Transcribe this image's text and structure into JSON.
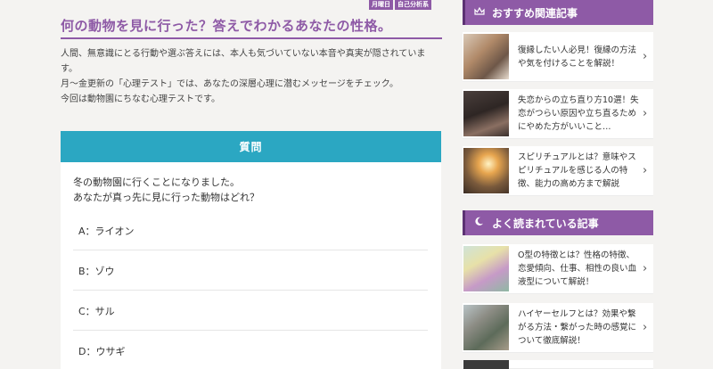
{
  "main": {
    "tags": [
      "月曜日",
      "自己分析系"
    ],
    "title": "何の動物を見に行った？答えでわかるあなたの性格。",
    "lead": [
      "人間、無意識にとる行動や選ぶ答えには、本人も気づいていない本音や真実が隠されています。",
      "月～金更新の「心理テスト」では、あなたの深層心理に潜むメッセージをチェック。",
      "今回は動物園にちなむ心理テストです。"
    ],
    "question": {
      "header": "質問",
      "lines": [
        "冬の動物園に行くことになりました。",
        "あなたが真っ先に見に行った動物はどれ？"
      ],
      "options": [
        "A：ライオン",
        "B：ゾウ",
        "C：サル",
        "D：ウサギ"
      ]
    }
  },
  "sidebar": {
    "recommended": {
      "title": "おすすめ関連記事",
      "icon": "crown-icon",
      "items": [
        {
          "text": "復縁したい人必見！復縁の方法や気を付けることを解説！"
        },
        {
          "text": "失恋からの立ち直り方10選！失恋がつらい原因や立ち直るためにやめた方がいいこと…"
        },
        {
          "text": "スピリチュアルとは？意味やスピリチュアルを感じる人の特徴、能力の高め方まで解説"
        }
      ]
    },
    "popular": {
      "title": "よく読まれている記事",
      "icon": "moon-icon",
      "items": [
        {
          "text": "O型の特徴とは？性格の特徴、恋愛傾向、仕事、相性の良い血液型について解説！"
        },
        {
          "text": "ハイヤーセルフとは？効果や繋がる方法・繋がった時の感覚について徹底解説！"
        }
      ]
    }
  },
  "colors": {
    "accent": "#8e5aa6",
    "question": "#2ba7c2"
  }
}
